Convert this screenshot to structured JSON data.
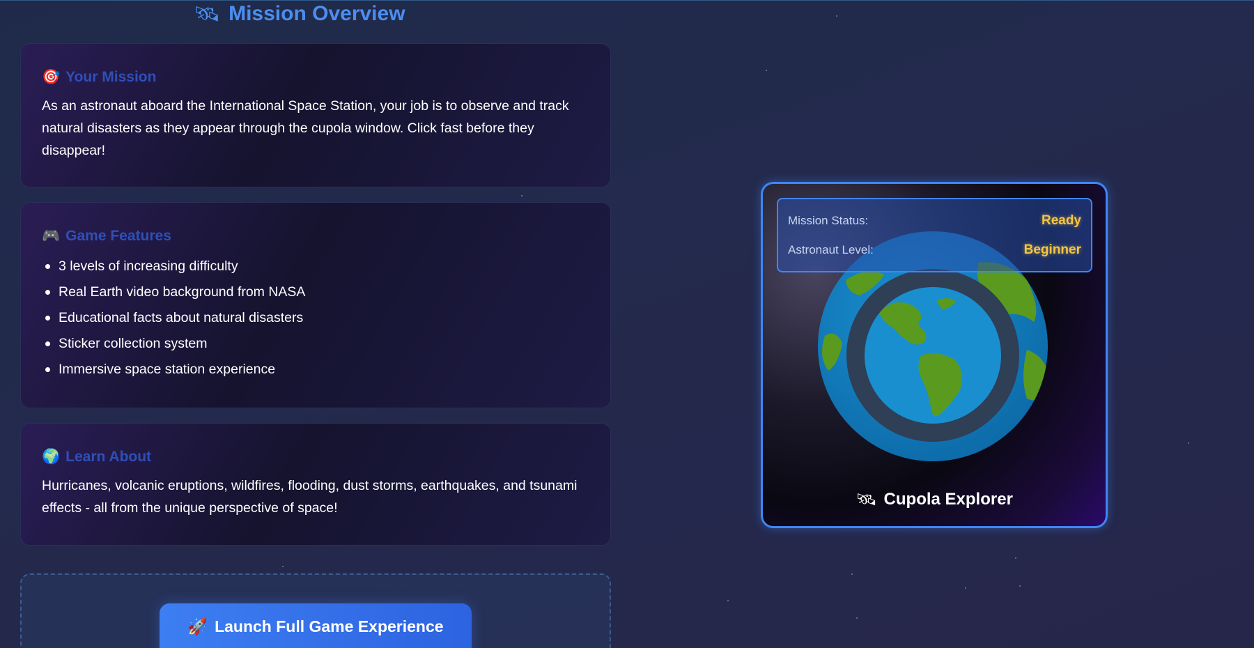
{
  "header": {
    "icon": "satellite-icon",
    "icon_glyph": "🛰",
    "title": "Mission Overview"
  },
  "cards": {
    "mission": {
      "icon": "target-icon",
      "icon_glyph": "🎯",
      "heading": "Your Mission",
      "text": "As an astronaut aboard the International Space Station, your job is to observe and track natural disasters as they appear through the cupola window. Click fast before they disappear!"
    },
    "features": {
      "icon": "gamepad-icon",
      "icon_glyph": "🎮",
      "heading": "Game Features",
      "items": [
        "3 levels of increasing difficulty",
        "Real Earth video background from NASA",
        "Educational facts about natural disasters",
        "Sticker collection system",
        "Immersive space station experience"
      ]
    },
    "learn": {
      "icon": "globe-icon",
      "icon_glyph": "🌍",
      "heading": "Learn About",
      "text": "Hurricanes, volcanic eruptions, wildfires, flooding, dust storms, earthquakes, and tsunami effects - all from the unique perspective of space!"
    }
  },
  "launch": {
    "icon": "rocket-icon",
    "icon_glyph": "🚀",
    "label": "Launch Full Game Experience"
  },
  "preview": {
    "status_label": "Mission Status:",
    "status_value": "Ready",
    "level_label": "Astronaut Level:",
    "level_value": "Beginner",
    "icon": "satellite-icon",
    "icon_glyph": "🛰",
    "title": "Cupola Explorer"
  },
  "colors": {
    "accent": "#4a8ef0",
    "card_heading": "#2f4fb8",
    "status_value": "#f4c542",
    "border": "#3f86f5"
  }
}
